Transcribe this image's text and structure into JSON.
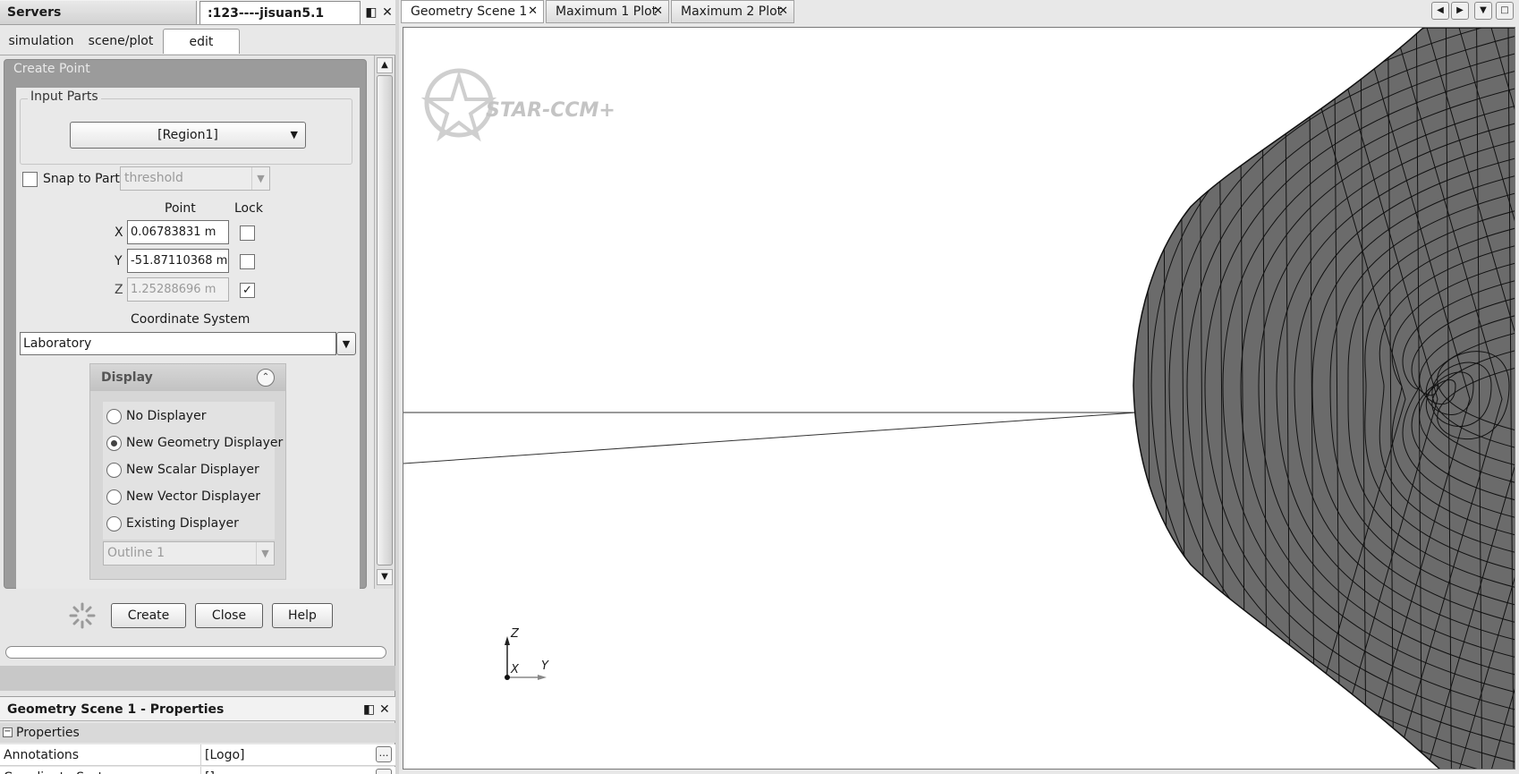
{
  "left_header": {
    "servers_tab": "Servers",
    "sim_tab": ":123----jisuan5.1"
  },
  "sub_tabs": [
    "simulation",
    "scene/plot",
    "edit"
  ],
  "create_point": {
    "title": "Create Point",
    "input_parts": {
      "legend": "Input Parts",
      "value": "[Region1]"
    },
    "snap": {
      "label": "Snap to Part",
      "checked": false,
      "value": "threshold"
    },
    "point_header": "Point",
    "lock_header": "Lock",
    "coords": [
      {
        "axis": "X",
        "value": "0.06783831 m",
        "locked": false
      },
      {
        "axis": "Y",
        "value": "-51.87110368 m",
        "locked": false
      },
      {
        "axis": "Z",
        "value": "1.25288696 m",
        "locked": true
      }
    ],
    "coordinate_system": {
      "label": "Coordinate System",
      "value": "Laboratory"
    },
    "display": {
      "title": "Display",
      "options": [
        "No Displayer",
        "New Geometry Displayer",
        "New Scalar Displayer",
        "New Vector Displayer",
        "Existing Displayer"
      ],
      "selected": "New Geometry Displayer",
      "existing_value": "Outline 1"
    }
  },
  "buttons": {
    "create": "Create",
    "close": "Close",
    "help": "Help"
  },
  "properties": {
    "header": "Geometry Scene 1 - Properties",
    "section": "Properties",
    "rows": [
      {
        "key": "Annotations",
        "value": "[Logo]"
      },
      {
        "key": "Coordinate System",
        "value": "[]"
      }
    ]
  },
  "doc_tabs": [
    "Geometry Scene 1",
    "Maximum 1 Plot",
    "Maximum 2 Plot"
  ],
  "viewport": {
    "logo_text": "STAR-CCM+",
    "triad": {
      "z": "Z",
      "x": "X",
      "y": "Y"
    }
  },
  "icons": {
    "panel_minimize": "minimize-pin-icon",
    "panel_close": "close-icon",
    "spinner": "busy-spinner-icon",
    "collapse": "collapse-up-icon",
    "ellipsis": "ellipsis-icon",
    "win_prev": "prev-icon",
    "win_next": "next-icon",
    "win_menu": "dropdown-icon",
    "win_max": "maximize-icon"
  }
}
